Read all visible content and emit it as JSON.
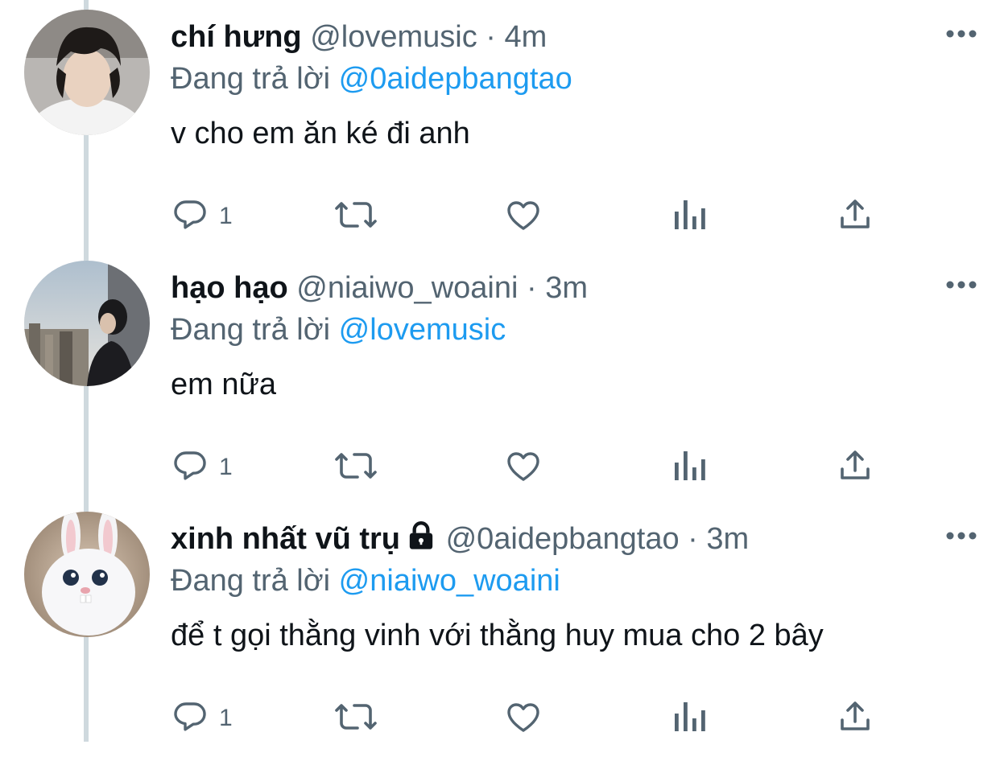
{
  "tweets": [
    {
      "name": "chí hưng",
      "handle": "@lovemusic",
      "separator": "·",
      "time": "4m",
      "reply_prefix": "Đang trả lời",
      "reply_to": "@0aidepbangtao",
      "text": "v cho em ăn ké đi anh",
      "reply_count": "1",
      "locked": false,
      "avatar": "avatar-boy-curly-hair"
    },
    {
      "name": "hạo hạo",
      "handle": "@niaiwo_woaini",
      "separator": "·",
      "time": "3m",
      "reply_prefix": "Đang trả lời",
      "reply_to": "@lovemusic",
      "text": "em nữa",
      "reply_count": "1",
      "locked": false,
      "avatar": "avatar-city-window"
    },
    {
      "name": "xinh nhất vũ trụ",
      "handle": "@0aidepbangtao",
      "separator": "·",
      "time": "3m",
      "reply_prefix": "Đang trả lời",
      "reply_to": "@niaiwo_woaini",
      "text": "để t gọi thằng vinh với thằng huy mua cho 2 bây",
      "reply_count": "1",
      "locked": true,
      "avatar": "avatar-white-rabbit"
    }
  ],
  "icons": {
    "reply": "reply-icon",
    "retweet": "retweet-icon",
    "like": "like-icon",
    "views": "views-icon",
    "share": "share-icon",
    "more": "more-icon",
    "lock": "lock-icon"
  },
  "colors": {
    "text": "#0f1419",
    "secondary": "#536471",
    "link": "#1d9bf0",
    "thread_line": "#cfd9de"
  }
}
